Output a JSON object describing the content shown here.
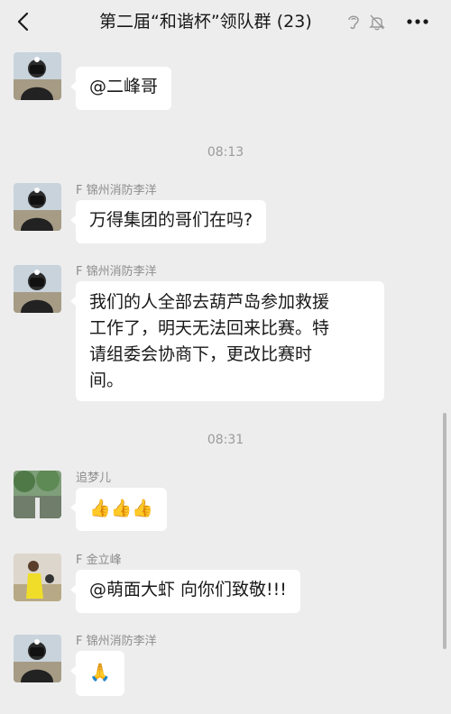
{
  "header": {
    "title": "第二届“和谐杯”领队群 (23)",
    "back_icon": "chevron-left-icon",
    "ear_icon": "ear-icon",
    "mute_icon": "bell-off-icon",
    "more_icon": "more-icon"
  },
  "messages": [
    {
      "sender": "F 锦州消防李洋",
      "text": "@二峰哥",
      "avatar": "firefighter-avatar"
    },
    {
      "time": "08:13"
    },
    {
      "sender": "F 锦州消防李洋",
      "text": "万得集团的哥们在吗?",
      "avatar": "firefighter-avatar"
    },
    {
      "sender": "F 锦州消防李洋",
      "lines": [
        "我们的人全部去葫芦岛参加救援",
        "工作了，明天无法回来比赛。特",
        "请组委会协商下，更改比赛时",
        "间。"
      ],
      "avatar": "firefighter-avatar"
    },
    {
      "time": "08:31"
    },
    {
      "sender": "追梦儿",
      "text": "👍👍👍",
      "avatar": "scenery-avatar"
    },
    {
      "sender": "F 金立峰",
      "text": "@萌面大虾 向你们致敬!!!",
      "avatar": "person-avatar"
    },
    {
      "sender": "F 锦州消防李洋",
      "text": "🙏",
      "avatar": "firefighter-avatar"
    }
  ]
}
